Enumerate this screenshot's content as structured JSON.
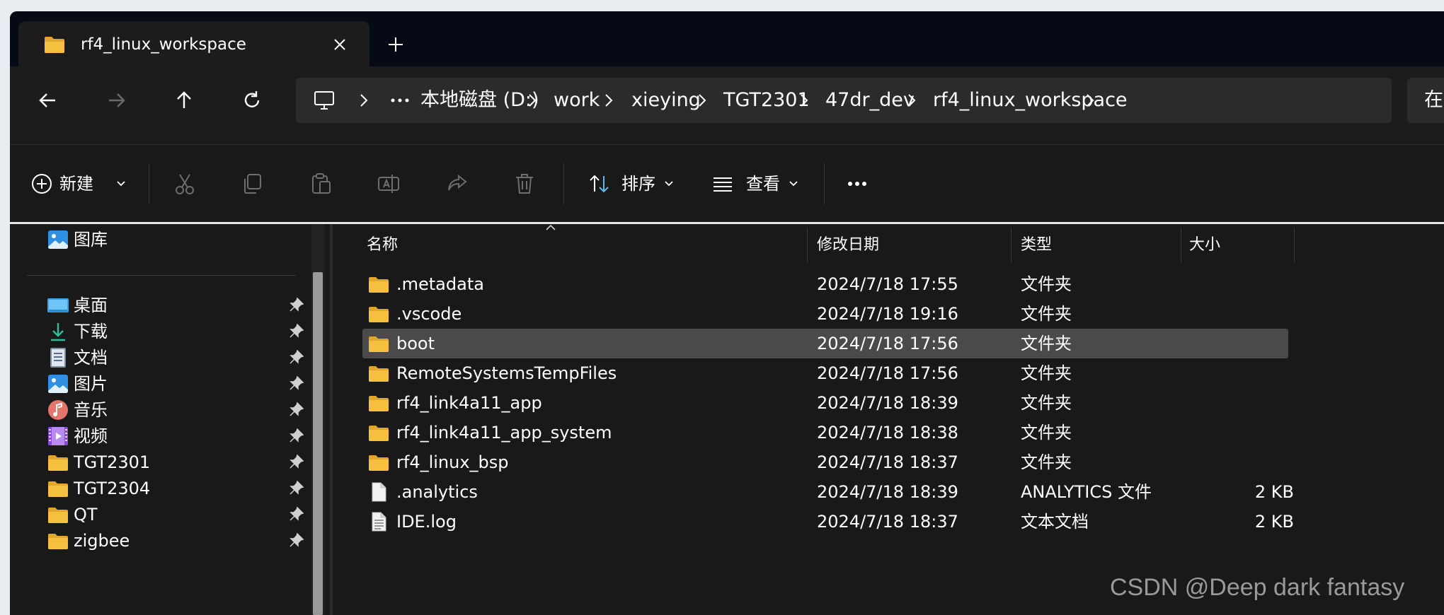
{
  "tab": {
    "title": "rf4_linux_workspace",
    "icon": "folder-icon"
  },
  "address": {
    "segments": [
      "本地磁盘 (D:)",
      "work",
      "xieying",
      "TGT2301",
      "47dr_dev",
      "rf4_linux_workspace"
    ],
    "search_text": "在 r"
  },
  "toolbar": {
    "new_label": "新建",
    "sort_label": "排序",
    "view_label": "查看"
  },
  "sidebar": {
    "gallery": "图库",
    "items": [
      {
        "label": "桌面",
        "icon": "desktop-icon",
        "pinned": true
      },
      {
        "label": "下载",
        "icon": "download-icon",
        "pinned": true
      },
      {
        "label": "文档",
        "icon": "document-icon",
        "pinned": true
      },
      {
        "label": "图片",
        "icon": "pictures-icon",
        "pinned": true
      },
      {
        "label": "音乐",
        "icon": "music-icon",
        "pinned": true
      },
      {
        "label": "视频",
        "icon": "video-icon",
        "pinned": true
      },
      {
        "label": "TGT2301",
        "icon": "folder-icon",
        "pinned": true
      },
      {
        "label": "TGT2304",
        "icon": "folder-icon",
        "pinned": true
      },
      {
        "label": "QT",
        "icon": "folder-icon",
        "pinned": true
      },
      {
        "label": "zigbee",
        "icon": "folder-icon",
        "pinned": true
      }
    ]
  },
  "columns": {
    "name": "名称",
    "modified": "修改日期",
    "type": "类型",
    "size": "大小"
  },
  "files": [
    {
      "name": ".metadata",
      "modified": "2024/7/18 17:55",
      "type": "文件夹",
      "size": "",
      "kind": "folder"
    },
    {
      "name": ".vscode",
      "modified": "2024/7/18 19:16",
      "type": "文件夹",
      "size": "",
      "kind": "folder"
    },
    {
      "name": "boot",
      "modified": "2024/7/18 17:56",
      "type": "文件夹",
      "size": "",
      "kind": "folder",
      "selected": true
    },
    {
      "name": "RemoteSystemsTempFiles",
      "modified": "2024/7/18 17:56",
      "type": "文件夹",
      "size": "",
      "kind": "folder"
    },
    {
      "name": "rf4_link4a11_app",
      "modified": "2024/7/18 18:39",
      "type": "文件夹",
      "size": "",
      "kind": "folder"
    },
    {
      "name": "rf4_link4a11_app_system",
      "modified": "2024/7/18 18:38",
      "type": "文件夹",
      "size": "",
      "kind": "folder"
    },
    {
      "name": "rf4_linux_bsp",
      "modified": "2024/7/18 18:37",
      "type": "文件夹",
      "size": "",
      "kind": "folder"
    },
    {
      "name": ".analytics",
      "modified": "2024/7/18 18:39",
      "type": "ANALYTICS 文件",
      "size": "2 KB",
      "kind": "file"
    },
    {
      "name": "IDE.log",
      "modified": "2024/7/18 18:37",
      "type": "文本文档",
      "size": "2 KB",
      "kind": "text"
    }
  ],
  "watermark": "CSDN @Deep dark fantasy",
  "colors": {
    "folder": "#f4c03e",
    "background": "#191919",
    "selected_row": "#4a4a4a"
  }
}
